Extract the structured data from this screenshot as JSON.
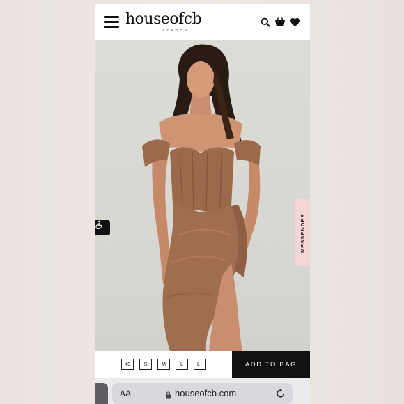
{
  "header": {
    "logo_text": "houseofcb",
    "logo_subtext": "LONDON",
    "icons": [
      "menu-icon",
      "search-icon",
      "bag-icon",
      "heart-icon"
    ]
  },
  "product": {
    "dress_color": "#9c6a4b"
  },
  "side_tabs": {
    "messenger_label": "MESSENGER"
  },
  "sizes": [
    "XS",
    "S",
    "M",
    "L",
    "L+"
  ],
  "cart": {
    "add_to_bag_label": "ADD TO BAG"
  },
  "browser": {
    "aa_label": "AA",
    "url": "houseofcb.com"
  },
  "colors": {
    "accent_black": "#111111",
    "messenger_pink": "#f4d6d8"
  }
}
